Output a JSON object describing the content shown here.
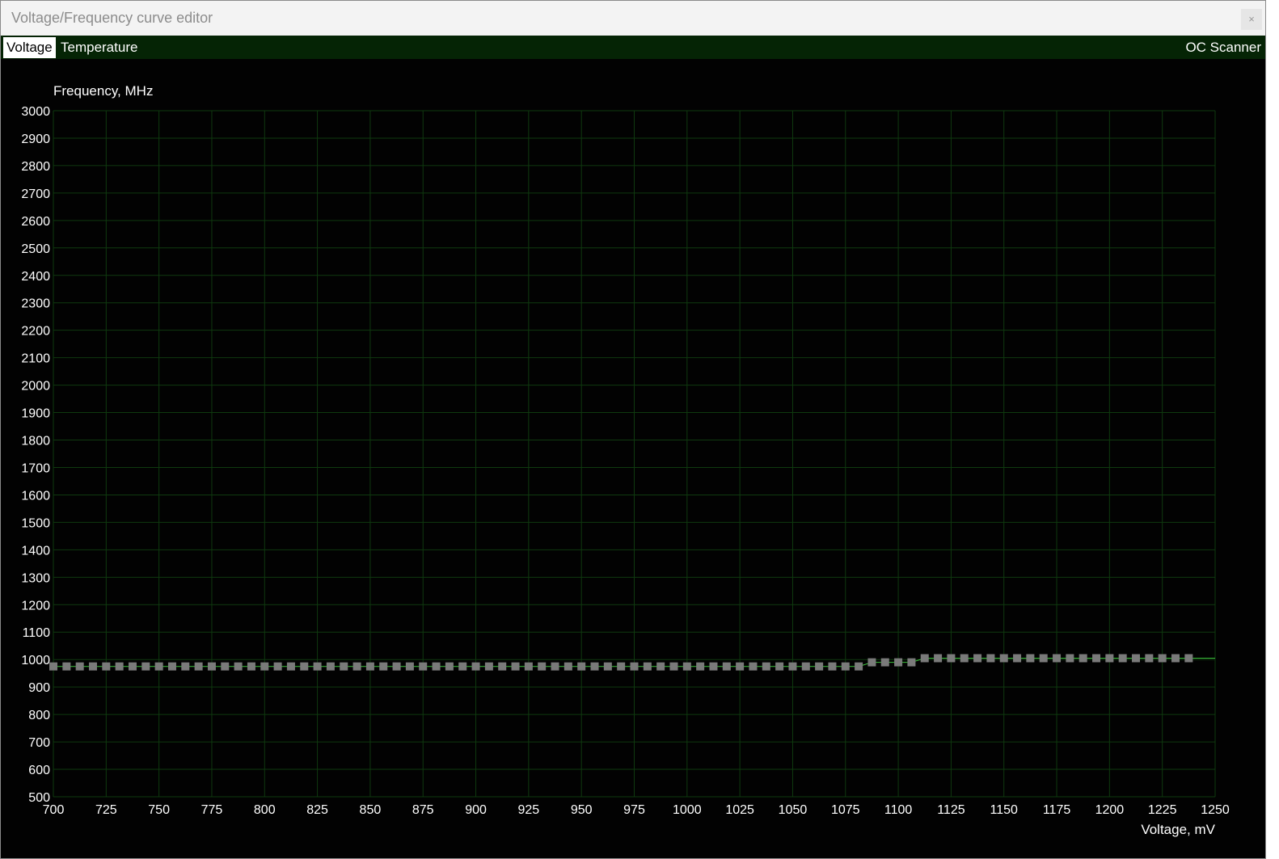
{
  "window": {
    "title": "Voltage/Frequency curve editor",
    "close_glyph": "×"
  },
  "tabs": [
    {
      "label": "Voltage",
      "active": true
    },
    {
      "label": "Temperature",
      "active": false
    }
  ],
  "oc_scanner_label": "OC Scanner",
  "icons": {
    "close": "close-icon"
  },
  "colors": {
    "background": "#020202",
    "grid": "#0f3a0f",
    "point": "#7a7a7a",
    "curve": "#3cc43c",
    "tabbar": "#052405"
  },
  "chart_data": {
    "type": "scatter",
    "ylabel": "Frequency, MHz",
    "xlabel": "Voltage, mV",
    "xlim": [
      700,
      1250
    ],
    "ylim": [
      500,
      3000
    ],
    "grid": true,
    "x_ticks": [
      700,
      725,
      750,
      775,
      800,
      825,
      850,
      875,
      900,
      925,
      950,
      975,
      1000,
      1025,
      1050,
      1075,
      1100,
      1125,
      1150,
      1175,
      1200,
      1225,
      1250
    ],
    "y_ticks": [
      500,
      600,
      700,
      800,
      900,
      1000,
      1100,
      1200,
      1300,
      1400,
      1500,
      1600,
      1700,
      1800,
      1900,
      2000,
      2100,
      2200,
      2300,
      2400,
      2500,
      2600,
      2700,
      2800,
      2900,
      3000
    ],
    "series": [
      {
        "points": [
          [
            700,
            975
          ],
          [
            706.25,
            975
          ],
          [
            712.5,
            975
          ],
          [
            718.75,
            975
          ],
          [
            725,
            975
          ],
          [
            731.25,
            975
          ],
          [
            737.5,
            975
          ],
          [
            743.75,
            975
          ],
          [
            750,
            975
          ],
          [
            756.25,
            975
          ],
          [
            762.5,
            975
          ],
          [
            768.75,
            975
          ],
          [
            775,
            975
          ],
          [
            781.25,
            975
          ],
          [
            787.5,
            975
          ],
          [
            793.75,
            975
          ],
          [
            800,
            975
          ],
          [
            806.25,
            975
          ],
          [
            812.5,
            975
          ],
          [
            818.75,
            975
          ],
          [
            825,
            975
          ],
          [
            831.25,
            975
          ],
          [
            837.5,
            975
          ],
          [
            843.75,
            975
          ],
          [
            850,
            975
          ],
          [
            856.25,
            975
          ],
          [
            862.5,
            975
          ],
          [
            868.75,
            975
          ],
          [
            875,
            975
          ],
          [
            881.25,
            975
          ],
          [
            887.5,
            975
          ],
          [
            893.75,
            975
          ],
          [
            900,
            975
          ],
          [
            906.25,
            975
          ],
          [
            912.5,
            975
          ],
          [
            918.75,
            975
          ],
          [
            925,
            975
          ],
          [
            931.25,
            975
          ],
          [
            937.5,
            975
          ],
          [
            943.75,
            975
          ],
          [
            950,
            975
          ],
          [
            956.25,
            975
          ],
          [
            962.5,
            975
          ],
          [
            968.75,
            975
          ],
          [
            975,
            975
          ],
          [
            981.25,
            975
          ],
          [
            987.5,
            975
          ],
          [
            993.75,
            975
          ],
          [
            1000,
            975
          ],
          [
            1006.25,
            975
          ],
          [
            1012.5,
            975
          ],
          [
            1018.75,
            975
          ],
          [
            1025,
            975
          ],
          [
            1031.25,
            975
          ],
          [
            1037.5,
            975
          ],
          [
            1043.75,
            975
          ],
          [
            1050,
            975
          ],
          [
            1056.25,
            975
          ],
          [
            1062.5,
            975
          ],
          [
            1068.75,
            975
          ],
          [
            1075,
            975
          ],
          [
            1081.25,
            975
          ],
          [
            1087.5,
            990
          ],
          [
            1093.75,
            990
          ],
          [
            1100,
            990
          ],
          [
            1106.25,
            990
          ],
          [
            1112.5,
            1005
          ],
          [
            1118.75,
            1005
          ],
          [
            1125,
            1005
          ],
          [
            1131.25,
            1005
          ],
          [
            1137.5,
            1005
          ],
          [
            1143.75,
            1005
          ],
          [
            1150,
            1005
          ],
          [
            1156.25,
            1005
          ],
          [
            1162.5,
            1005
          ],
          [
            1168.75,
            1005
          ],
          [
            1175,
            1005
          ],
          [
            1181.25,
            1005
          ],
          [
            1187.5,
            1005
          ],
          [
            1193.75,
            1005
          ],
          [
            1200,
            1005
          ],
          [
            1206.25,
            1005
          ],
          [
            1212.5,
            1005
          ],
          [
            1218.75,
            1005
          ],
          [
            1225,
            1005
          ],
          [
            1231.25,
            1005
          ],
          [
            1237.5,
            1005
          ]
        ]
      }
    ]
  }
}
